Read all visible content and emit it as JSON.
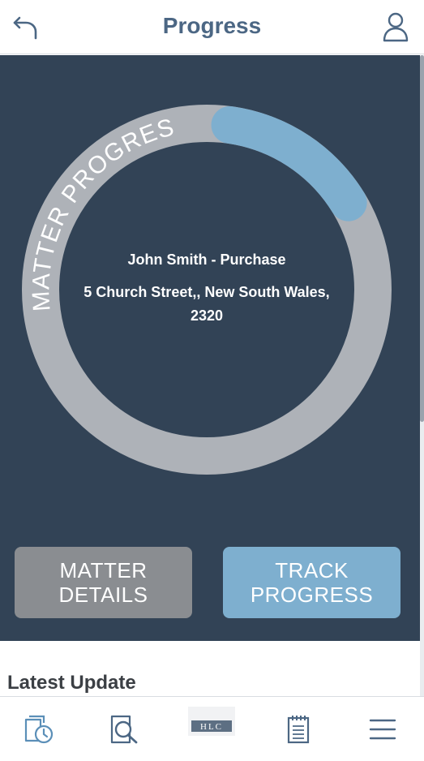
{
  "header": {
    "title": "Progress",
    "back_icon": "back-arrow-icon",
    "user_icon": "user-icon",
    "title_color": "#4c6784"
  },
  "progress": {
    "ring_label": "MATTER PROGRESS",
    "fraction": 0.14,
    "track_color": "#aeb2b8",
    "fill_color": "#7eafcf"
  },
  "matter": {
    "name": "John Smith - Purchase",
    "address": "5 Church Street,, New South Wales, 2320"
  },
  "buttons": {
    "details_label": "MATTER DETAILS",
    "track_label": "TRACK PROGRESS"
  },
  "section": {
    "latest_update": "Latest Update"
  },
  "nav": {
    "items": [
      {
        "icon": "timeline-icon"
      },
      {
        "icon": "document-search-icon"
      },
      {
        "icon": "hlc-logo",
        "text": "HLC"
      },
      {
        "icon": "notepad-icon"
      },
      {
        "icon": "menu-icon"
      }
    ]
  },
  "colors": {
    "hero_background": "#324356",
    "details_button": "#8a8d91",
    "track_button": "#7eafcf"
  }
}
